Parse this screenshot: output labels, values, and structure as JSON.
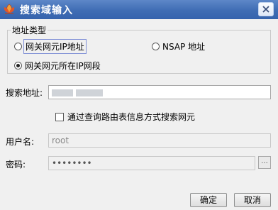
{
  "window": {
    "title": "搜索域输入",
    "icon": "lotus-logo-icon",
    "close_icon": "close-icon"
  },
  "address_type": {
    "legend": "地址类型",
    "options": [
      {
        "label": "网关网元IP地址",
        "selected": false,
        "focused": true
      },
      {
        "label": "NSAP 地址",
        "selected": false
      },
      {
        "label": "网关网元所在IP网段",
        "selected": true
      }
    ]
  },
  "search_address": {
    "label": "搜索地址:",
    "value": ""
  },
  "route_table_checkbox": {
    "label": "通过查询路由表信息方式搜索网元",
    "checked": false
  },
  "username": {
    "label": "用户名:",
    "value": "root"
  },
  "password": {
    "label": "密码:",
    "value": "••••••••",
    "browse_label": "..."
  },
  "buttons": {
    "ok": "确定",
    "cancel": "取消"
  }
}
